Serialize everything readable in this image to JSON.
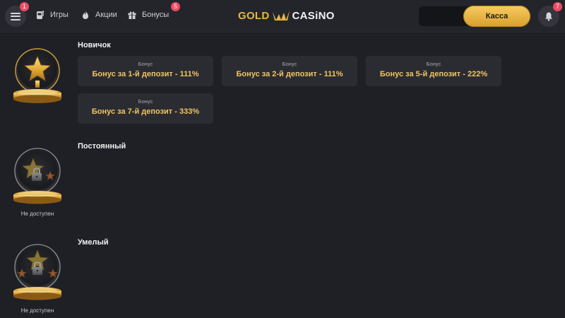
{
  "header": {
    "menu_badge": "1",
    "nav": [
      {
        "label": "Игры",
        "icon": "slot-machine-icon"
      },
      {
        "label": "Акции",
        "icon": "flame-icon"
      },
      {
        "label": "Бонусы",
        "icon": "gift-icon",
        "badge": "5"
      }
    ],
    "logo": {
      "gold": "GOLD",
      "casino": "CASiNO"
    },
    "cashier_label": "Касса",
    "bell_badge": "7"
  },
  "levels": [
    {
      "title": "Новичок",
      "status": "",
      "bonuses": [
        {
          "caption": "Бонус",
          "title": "Бонус за 1-й депозит - 111%"
        },
        {
          "caption": "Бонус",
          "title": "Бонус за 2-й депозит - 111%"
        },
        {
          "caption": "Бонус",
          "title": "Бонус за 5-й депозит - 222%"
        },
        {
          "caption": "Бонус",
          "title": "Бонус за 7-й депозит - 333%"
        }
      ]
    },
    {
      "title": "Постоянный",
      "status": "Не доступен",
      "bonuses": []
    },
    {
      "title": "Умелый",
      "status": "Не доступен",
      "bonuses": []
    }
  ],
  "colors": {
    "background": "#1f2026",
    "card": "#2b2c32",
    "accent_gold": "#f0c463",
    "badge": "#ef4a64"
  }
}
